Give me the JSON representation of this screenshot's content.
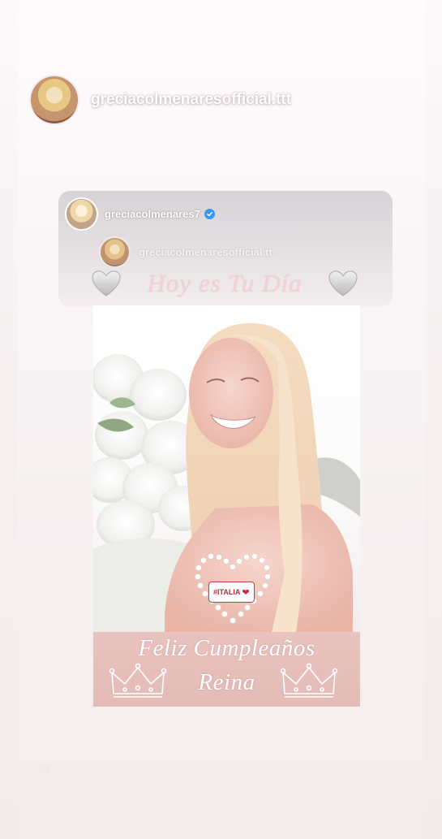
{
  "story": {
    "author": {
      "username": "greciacolmenaresofficial.ttt"
    },
    "shared_post": {
      "username": "greciacolmenares7",
      "verified": true,
      "inner_author": "greciacolmenaresofficial.tt",
      "greeting": "Hoy es Tu Día",
      "sticker_tag": "#ITALIA",
      "banner_line1": "Feliz Cumpleaños",
      "banner_line2": "Reina"
    },
    "corner_mark": "23"
  },
  "colors": {
    "verified_blue": "#3a97f0",
    "banner_pink": "#e6bfba",
    "greeting_pink": "#f3d2d6",
    "sticker_red": "#c53a47"
  },
  "icons": [
    "verified-badge-icon",
    "grey-heart-icon",
    "crown-icon",
    "heart-frame-icon"
  ]
}
